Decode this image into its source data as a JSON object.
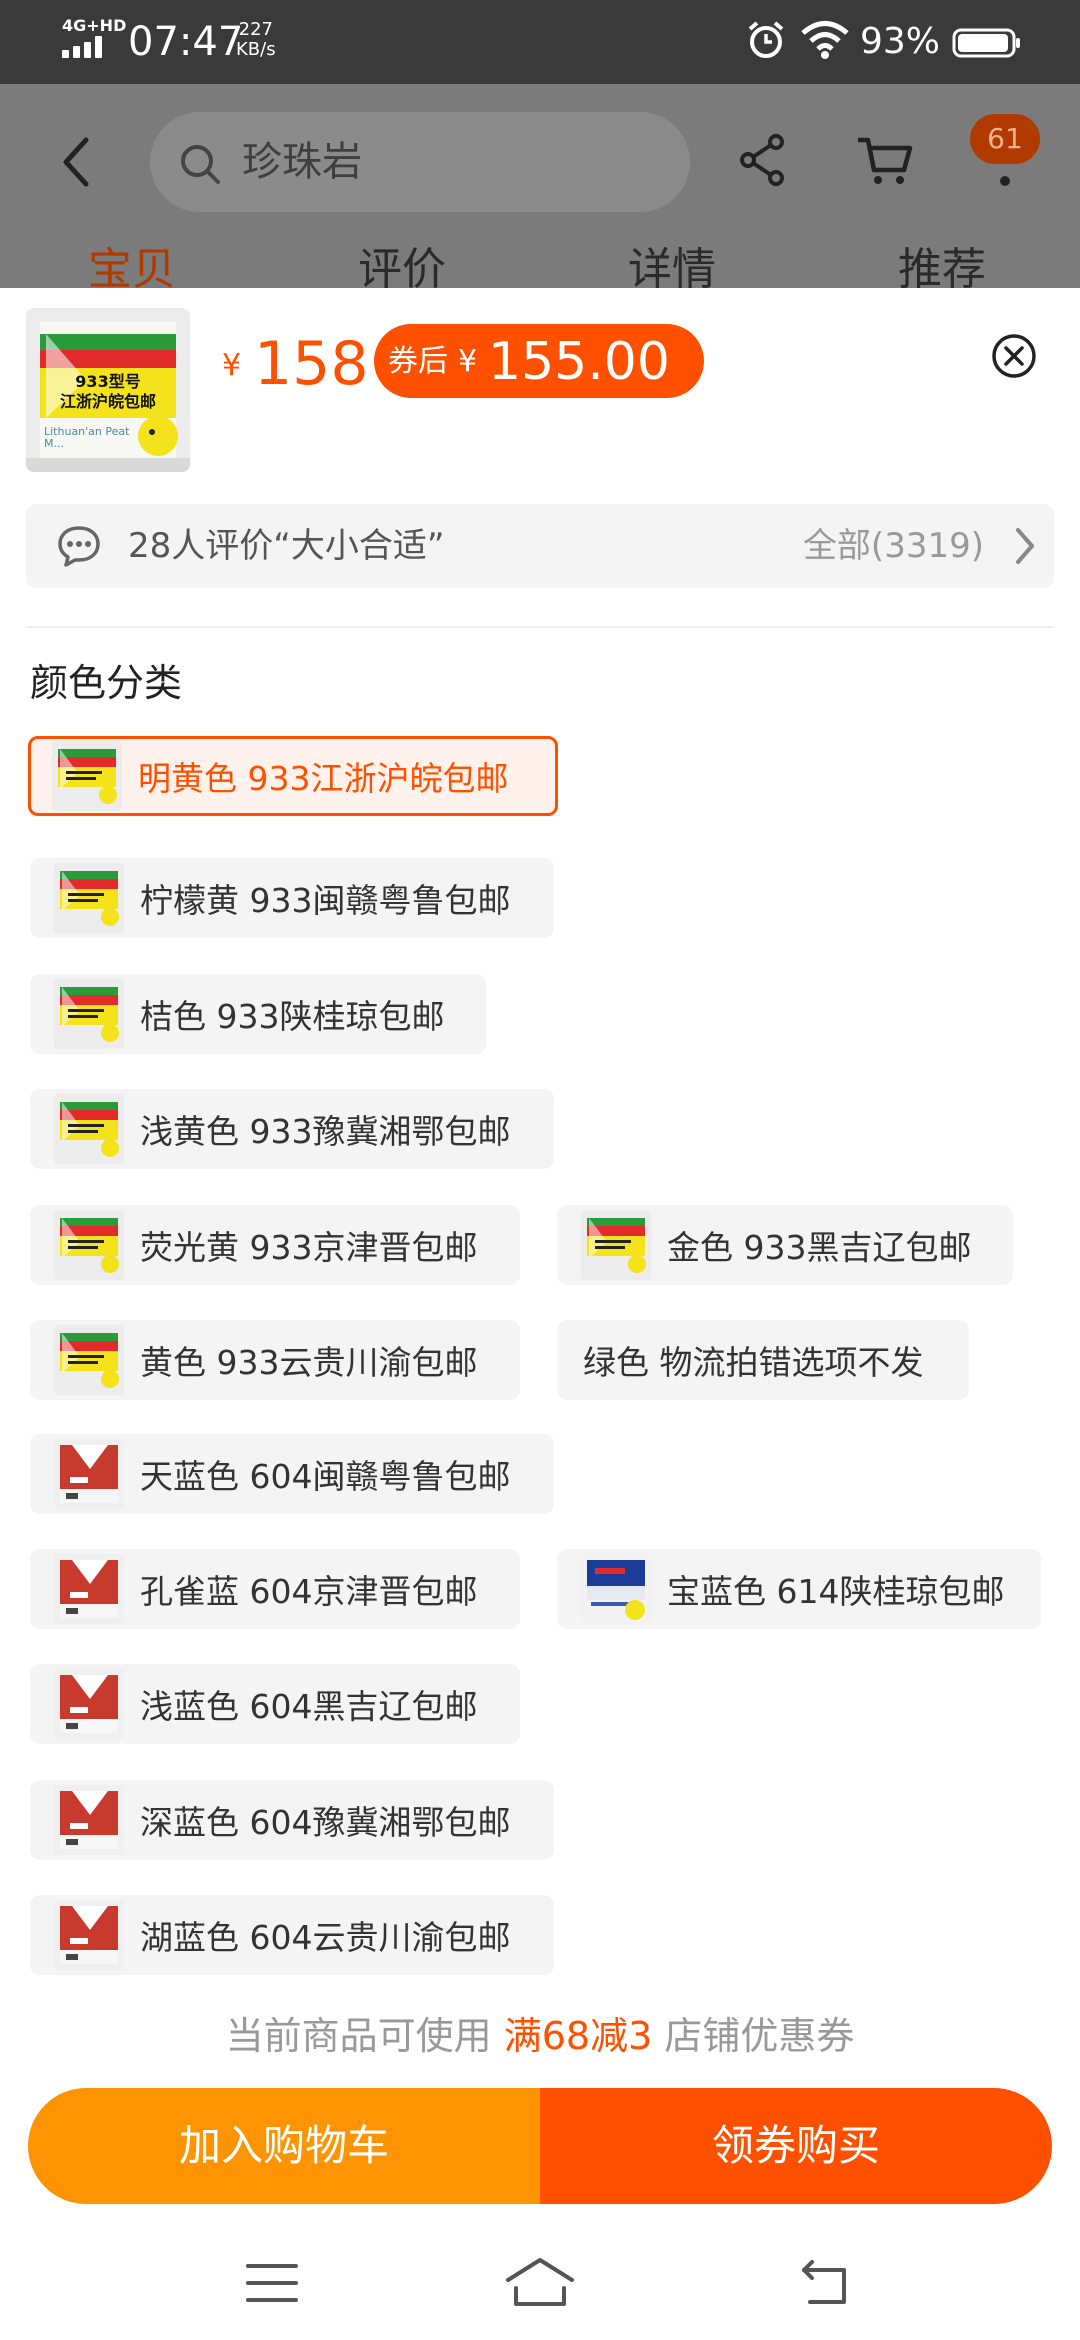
{
  "status_bar": {
    "network": "4G+HD",
    "time": "07:47",
    "speed_value": "227",
    "speed_unit": "KB/s",
    "battery": "93%"
  },
  "background_page": {
    "search_placeholder": "珍珠岩",
    "cart_badge": "61",
    "tabs": [
      "宝贝",
      "评价",
      "详情",
      "推荐"
    ]
  },
  "product": {
    "price_symbol": "¥",
    "price": "158",
    "coupon_label": "券后",
    "coupon_symbol": "¥",
    "coupon_price": "155.00",
    "thumb_text_line1": "933型号",
    "thumb_text_line2": "江浙沪皖包邮",
    "thumb_brand": "Lithuan'an Peat M..."
  },
  "reviews": {
    "summary": "28人评价“大小合适”",
    "all": "全部(3319)"
  },
  "options": {
    "title": "颜色分类",
    "items": [
      {
        "label": "明黄色 933江浙沪皖包邮",
        "selected": true,
        "thumb": "yellow"
      },
      {
        "label": "柠檬黄 933闽赣粤鲁包邮",
        "selected": false,
        "thumb": "yellow"
      },
      {
        "label": "桔色 933陕桂琼包邮",
        "selected": false,
        "thumb": "yellow"
      },
      {
        "label": "浅黄色 933豫冀湘鄂包邮",
        "selected": false,
        "thumb": "yellow"
      },
      {
        "label": "荧光黄 933京津晋包邮",
        "selected": false,
        "thumb": "yellow"
      },
      {
        "label": "金色 933黑吉辽包邮",
        "selected": false,
        "thumb": "yellow"
      },
      {
        "label": "黄色 933云贵川渝包邮",
        "selected": false,
        "thumb": "yellow"
      },
      {
        "label": "绿色 物流拍错选项不发",
        "selected": false,
        "thumb": "none"
      },
      {
        "label": "天蓝色 604闽赣粤鲁包邮",
        "selected": false,
        "thumb": "red"
      },
      {
        "label": "孔雀蓝 604京津晋包邮",
        "selected": false,
        "thumb": "red"
      },
      {
        "label": "宝蓝色 614陕桂琼包邮",
        "selected": false,
        "thumb": "blue"
      },
      {
        "label": "浅蓝色 604黑吉辽包邮",
        "selected": false,
        "thumb": "red"
      },
      {
        "label": "深蓝色 604豫冀湘鄂包邮",
        "selected": false,
        "thumb": "red"
      },
      {
        "label": "湖蓝色 604云贵川渝包邮",
        "selected": false,
        "thumb": "red"
      }
    ]
  },
  "coupon_note": {
    "prefix": "当前商品可使用",
    "highlight": "满68减3",
    "suffix": "店铺优惠券"
  },
  "actions": {
    "add_to_cart": "加入购物车",
    "buy": "领券购买"
  },
  "colors": {
    "accent": "#ff5000",
    "cart_button": "#ff9402",
    "status_bar": "#3a3a3a"
  },
  "icons": [
    "signal-icon",
    "alarm-icon",
    "wifi-icon",
    "battery-icon",
    "back-arrow-icon",
    "search-icon",
    "share-icon",
    "cart-icon",
    "more-icon",
    "close-icon",
    "chat-bubble-icon",
    "chevron-right-icon",
    "menu-icon",
    "home-icon",
    "return-icon"
  ]
}
